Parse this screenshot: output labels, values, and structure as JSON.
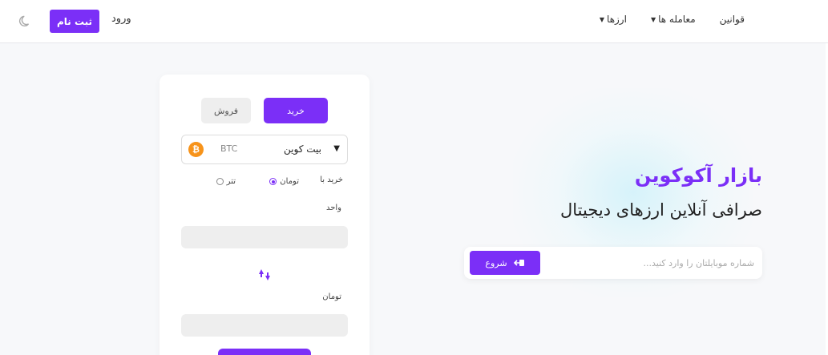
{
  "header": {
    "theme_icon": "moon-icon",
    "signup_label": "ثبت نام",
    "login_label": "ورود",
    "nav": [
      {
        "label": "ارزها",
        "has_dropdown": true
      },
      {
        "label": "معامله ها",
        "has_dropdown": true
      },
      {
        "label": "قوانین",
        "has_dropdown": false
      }
    ]
  },
  "hero": {
    "title": "بازار آکوکوین",
    "subtitle": "صرافی آنلاین ارزهای دیجیتال",
    "phone_placeholder": "شماره موبایلتان را وارد کنید...",
    "phone_value": "",
    "start_label": "شروع",
    "start_icon": "sign-in-icon"
  },
  "trade": {
    "buy_tab": "خرید",
    "sell_tab": "فروش",
    "active_tab": "buy",
    "coin": {
      "name": "بیت کوین",
      "symbol": "BTC",
      "icon": "bitcoin-icon",
      "symbol_char": "₿"
    },
    "buy_with_label": "خرید با",
    "pay_options": [
      {
        "label": "تومان",
        "checked": true
      },
      {
        "label": "تتر",
        "checked": false
      }
    ],
    "unit_label": "واحد",
    "unit_value": "",
    "toman_label": "تومان",
    "toman_value": "",
    "swap_icon": "swap-arrows-icon"
  },
  "colors": {
    "accent": "#7b2ff7",
    "bitcoin": "#f7931a",
    "input_bg": "#eeeeee",
    "page_bg": "#f7f8fa"
  }
}
